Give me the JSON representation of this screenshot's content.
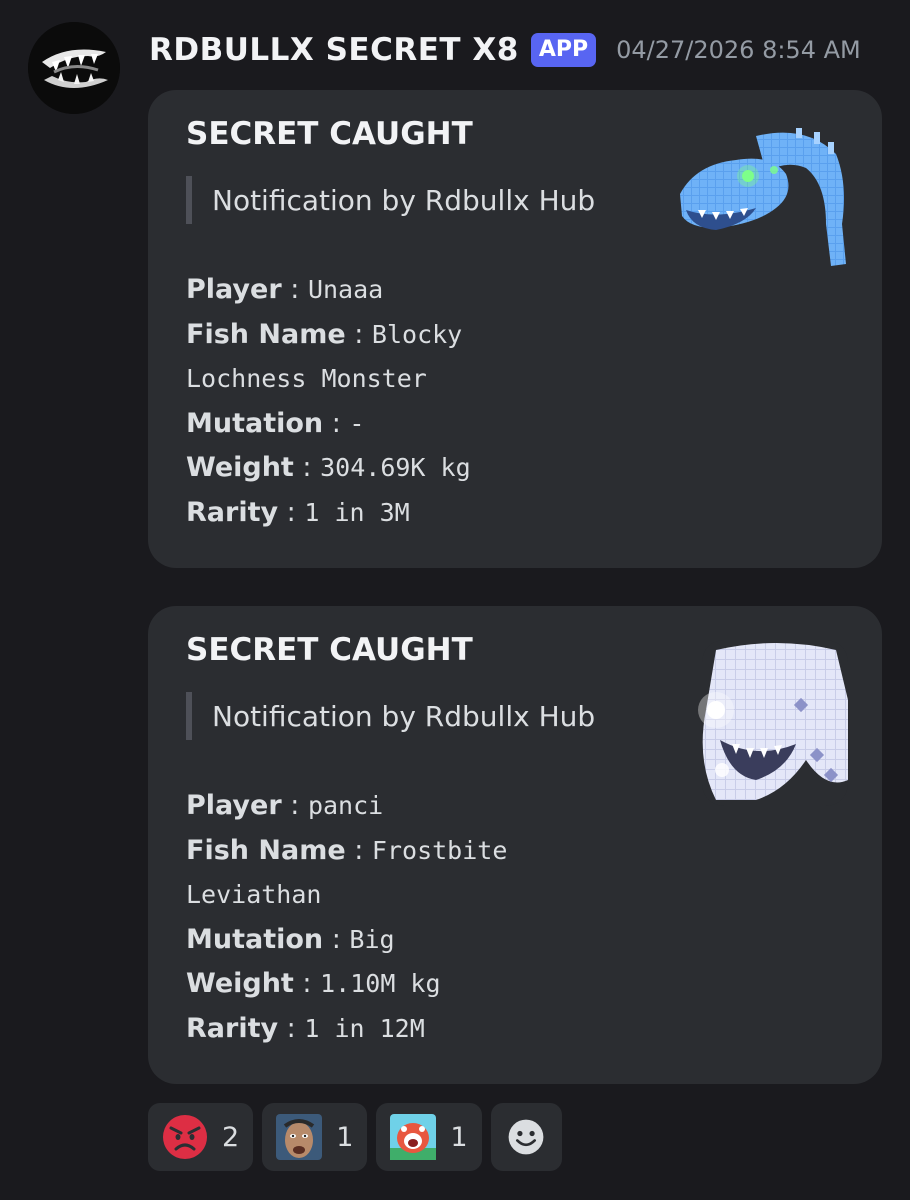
{
  "message": {
    "author": "RDBULLX SECRET X8",
    "badge": "APP",
    "timestamp": "04/27/2026 8:54 AM"
  },
  "embeds": [
    {
      "title": "SECRET CAUGHT",
      "quote": "Notification by Rdbullx Hub",
      "thumbnail": "blue-blocky-sea-serpent",
      "fields": {
        "player_label": "Player",
        "player_value": "Unaaa",
        "fish_label": "Fish Name",
        "fish_value_1": "Blocky",
        "fish_value_2": "Lochness Monster",
        "mutation_label": "Mutation",
        "mutation_value": "-",
        "weight_label": "Weight",
        "weight_value": "304.69K kg",
        "rarity_label": "Rarity",
        "rarity_value": "1 in 3M"
      }
    },
    {
      "title": "SECRET CAUGHT",
      "quote": "Notification by Rdbullx Hub",
      "thumbnail": "white-frost-leviathan",
      "fields": {
        "player_label": "Player",
        "player_value": "panci",
        "fish_label": "Fish Name",
        "fish_value_1": "Frostbite",
        "fish_value_2": "Leviathan",
        "mutation_label": "Mutation",
        "mutation_value": "Big",
        "weight_label": "Weight",
        "weight_value": "1.10M kg",
        "rarity_label": "Rarity",
        "rarity_value": "1 in 12M"
      }
    }
  ],
  "reactions": [
    {
      "emoji": "angry-face",
      "count": "2"
    },
    {
      "emoji": "custom-face-photo",
      "count": "1"
    },
    {
      "emoji": "custom-screaming-cartoon",
      "count": "1"
    }
  ],
  "add_reaction_icon": "add-reaction-smiley",
  "colors": {
    "background": "#1a1a1e",
    "embed": "#2b2d31",
    "badge": "#5865f2",
    "timestamp": "#949ba4",
    "quote_bar": "#4e5058"
  }
}
